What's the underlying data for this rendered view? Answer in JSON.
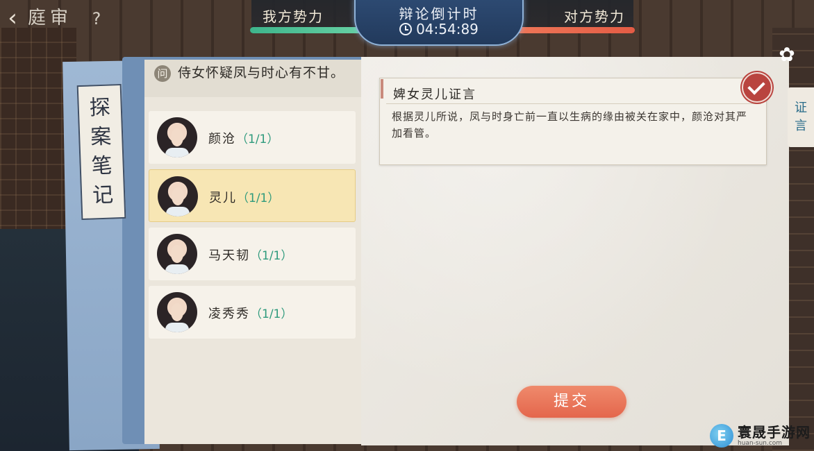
{
  "header": {
    "back_icon": "chevron-left-icon",
    "title": "庭审",
    "help_label": "?",
    "our_side": "我方势力",
    "their_side": "对方势力",
    "timer_title": "辩论倒计时",
    "timer_value": "04:54:89"
  },
  "notebook": {
    "spine_title": [
      "探",
      "案",
      "笔",
      "记"
    ]
  },
  "question": {
    "badge": "问",
    "text": "侍女怀疑凤与时心有不甘。"
  },
  "witnesses": [
    {
      "name": "颜沧",
      "count": "（1/1）",
      "selected": false
    },
    {
      "name": "灵儿",
      "count": "（1/1）",
      "selected": true
    },
    {
      "name": "马天韧",
      "count": "（1/1）",
      "selected": false
    },
    {
      "name": "凌秀秀",
      "count": "（1/1）",
      "selected": false
    }
  ],
  "testimony": {
    "title": "婢女灵儿证言",
    "body": "根据灵儿所说，凤与时身亡前一直以生病的缘由被关在家中，颜沧对其严加看管。"
  },
  "side_tab": [
    "证",
    "言"
  ],
  "submit_label": "提交",
  "watermark": {
    "logo": "E",
    "name": "寰晟手游网",
    "url": "huan-sun.com"
  },
  "colors": {
    "our_bar": "#3eb58c",
    "their_bar": "#e45c45",
    "accent_green": "#2e9a7c",
    "submit": "#e4664c"
  }
}
